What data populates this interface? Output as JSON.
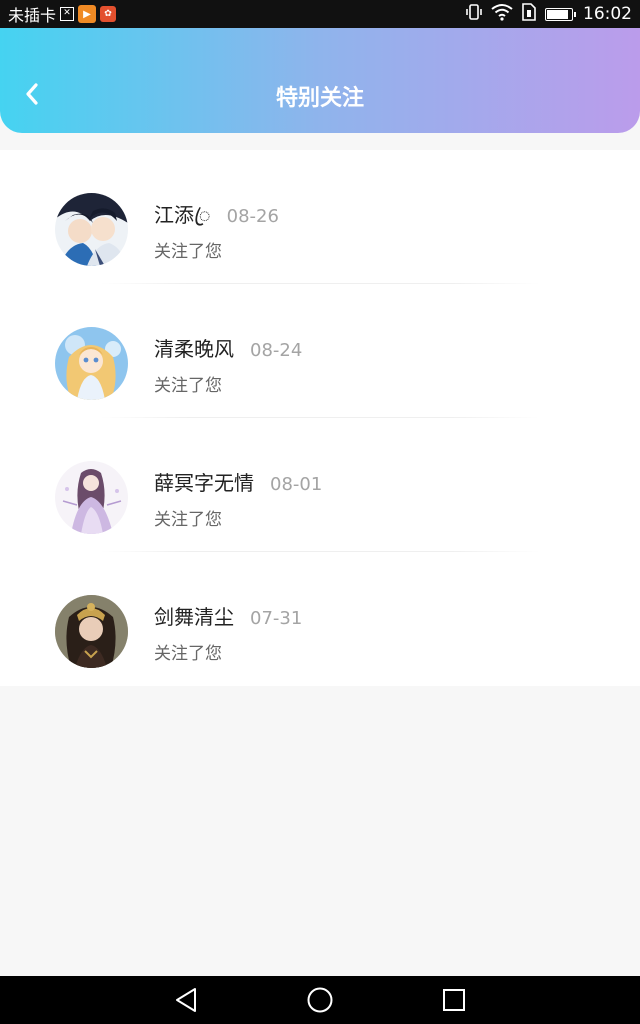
{
  "status_bar": {
    "carrier": "未插卡",
    "time": "16:02",
    "battery_level": 0.9
  },
  "header": {
    "title": "特别关注"
  },
  "colors": {
    "header_gradient_start": "#45d3f1",
    "header_gradient_end": "#bb9ceb",
    "name_text": "#222222",
    "date_text": "#a4a4a4",
    "desc_text": "#666666"
  },
  "icons": {
    "back": "chevron-left-icon",
    "nav_back": "triangle-back-icon",
    "nav_home": "circle-home-icon",
    "nav_recent": "square-recent-icon"
  },
  "follow_list": [
    {
      "name": "江添ꦿ",
      "date": "08-26",
      "desc": "关注了您"
    },
    {
      "name": "清柔晚风",
      "date": "08-24",
      "desc": "关注了您"
    },
    {
      "name": "薛冥字无情",
      "date": "08-01",
      "desc": "关注了您"
    },
    {
      "name": "剑舞清尘",
      "date": "07-31",
      "desc": "关注了您"
    }
  ]
}
